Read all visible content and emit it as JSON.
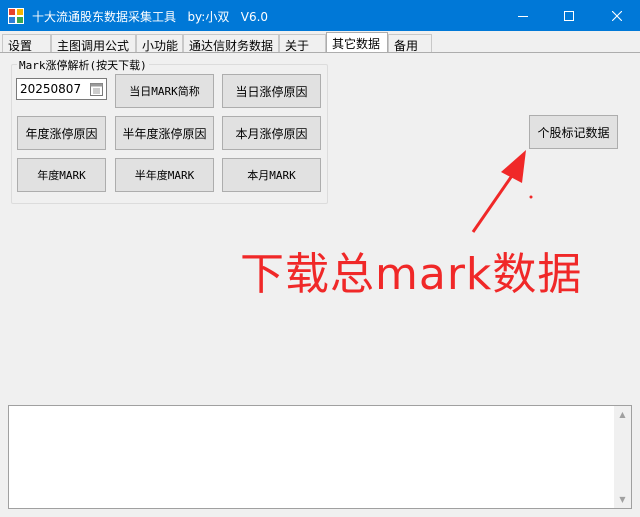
{
  "window": {
    "title": "十大流通股东数据采集工具   by:小双   V6.0"
  },
  "tabs": [
    {
      "label": "设置"
    },
    {
      "label": "主图调用公式"
    },
    {
      "label": "小功能"
    },
    {
      "label": "通达信财务数据"
    },
    {
      "label": "关于"
    },
    {
      "label": "其它数据"
    },
    {
      "label": "备用"
    }
  ],
  "active_tab": "其它数据",
  "group": {
    "legend": "Mark涨停解析(按天下载)",
    "date_value": "20250807",
    "buttons": {
      "today_mark_name": "当日MARK简称",
      "today_limit_reason": "当日涨停原因",
      "year_limit_reason": "年度涨停原因",
      "halfyear_limit_reason": "半年度涨停原因",
      "month_limit_reason": "本月涨停原因",
      "year_mark": "年度MARK",
      "halfyear_mark": "半年度MARK",
      "month_mark": "本月MARK"
    }
  },
  "stock_mark_button": "个股标记数据",
  "annotation": {
    "text": "下载总mark数据",
    "color": "#f02828"
  },
  "log_output": {
    "value": ""
  },
  "colors": {
    "titlebar": "#0078d7",
    "window_bg": "#f0f0f0",
    "button_bg": "#e1e1e1"
  }
}
